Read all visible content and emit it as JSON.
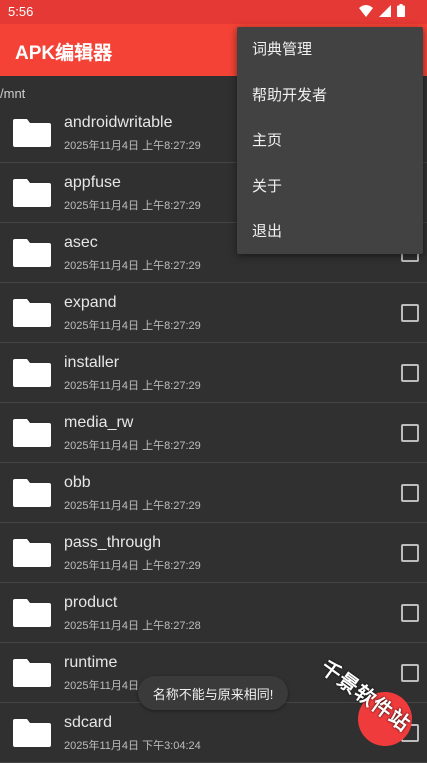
{
  "status": {
    "time": "5:56"
  },
  "appbar": {
    "title": "APK编辑器"
  },
  "path": "/mnt",
  "files": [
    {
      "name": "androidwritable",
      "date": "2025年11月4日 上午8:27:29"
    },
    {
      "name": "appfuse",
      "date": "2025年11月4日 上午8:27:29"
    },
    {
      "name": "asec",
      "date": "2025年11月4日 上午8:27:29"
    },
    {
      "name": "expand",
      "date": "2025年11月4日 上午8:27:29"
    },
    {
      "name": "installer",
      "date": "2025年11月4日 上午8:27:29"
    },
    {
      "name": "media_rw",
      "date": "2025年11月4日 上午8:27:29"
    },
    {
      "name": "obb",
      "date": "2025年11月4日 上午8:27:29"
    },
    {
      "name": "pass_through",
      "date": "2025年11月4日 上午8:27:29"
    },
    {
      "name": "product",
      "date": "2025年11月4日 上午8:27:28"
    },
    {
      "name": "runtime",
      "date": "2025年11月4日"
    },
    {
      "name": "sdcard",
      "date": "2025年11月4日 下午3:04:24"
    }
  ],
  "menu": {
    "items": [
      "词典管理",
      "帮助开发者",
      "主页",
      "关于",
      "退出"
    ]
  },
  "toast": "名称不能与原来相同!",
  "watermark": "千景软件站",
  "colors": {
    "appbar": "#f44336",
    "statusbar": "#e53935",
    "background": "#303030",
    "menu": "#424242"
  }
}
